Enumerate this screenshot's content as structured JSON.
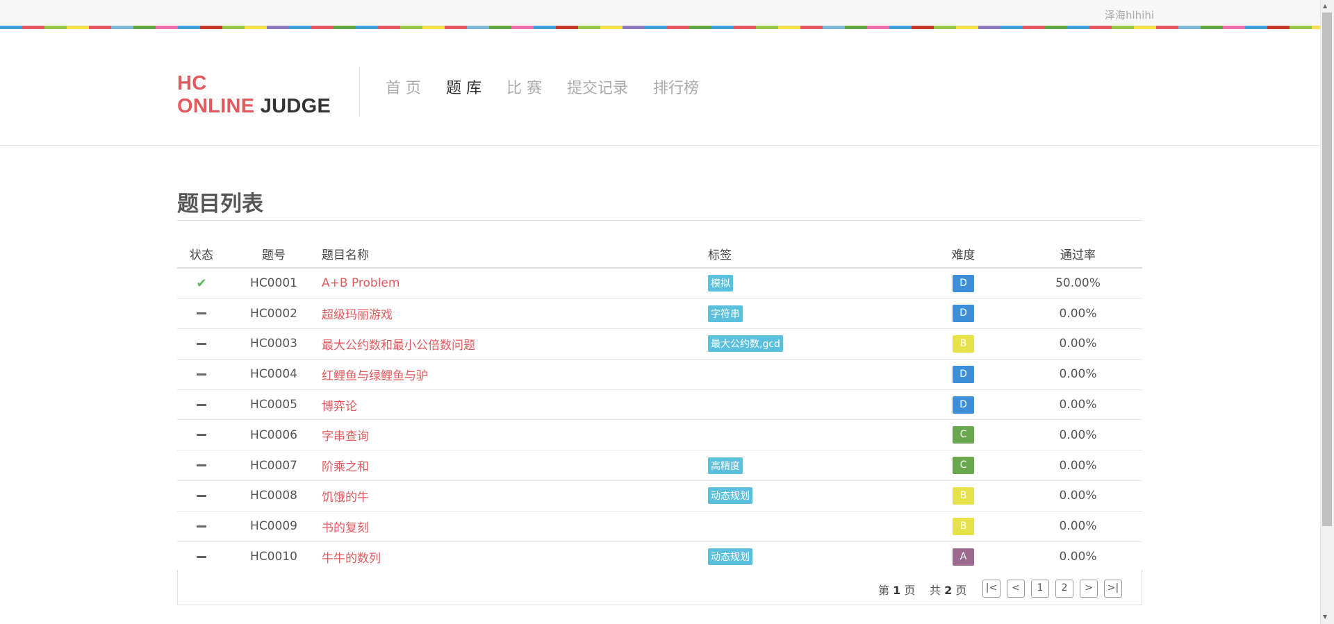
{
  "topbar": {
    "username": "泽海hlhihi"
  },
  "stripe_colors": [
    "#3ea3dc",
    "#e25a5e",
    "#9bc748",
    "#f4e04d",
    "#e25a5e",
    "#7fb7d6",
    "#5fa843",
    "#ee6fa8",
    "#3ea3dc",
    "#c0392b",
    "#9bc748",
    "#f4e04d",
    "#8e7cc3",
    "#3ea3dc",
    "#e25a5e",
    "#5fa843"
  ],
  "logo": {
    "line1": "HC",
    "line2_red": "ONLINE",
    "line2_dark": "JUDGE"
  },
  "nav": [
    {
      "label": "首 页",
      "active": false
    },
    {
      "label": "题 库",
      "active": true
    },
    {
      "label": "比 赛",
      "active": false
    },
    {
      "label": "提交记录",
      "active": false
    },
    {
      "label": "排行榜",
      "active": false
    }
  ],
  "page": {
    "title": "题目列表"
  },
  "table": {
    "headers": {
      "status": "状态",
      "id": "题号",
      "name": "题目名称",
      "tags": "标签",
      "difficulty": "难度",
      "rate": "通过率"
    },
    "rows": [
      {
        "status": "accepted",
        "id": "HC0001",
        "name": "A+B Problem",
        "tag": "模拟",
        "difficulty": "D",
        "rate": "50.00%"
      },
      {
        "status": "none",
        "id": "HC0002",
        "name": "超级玛丽游戏",
        "tag": "字符串",
        "difficulty": "D",
        "rate": "0.00%"
      },
      {
        "status": "none",
        "id": "HC0003",
        "name": "最大公约数和最小公倍数问题",
        "tag": "最大公约数,gcd",
        "difficulty": "B",
        "rate": "0.00%"
      },
      {
        "status": "none",
        "id": "HC0004",
        "name": "红鲤鱼与绿鲤鱼与驴",
        "tag": "",
        "difficulty": "D",
        "rate": "0.00%"
      },
      {
        "status": "none",
        "id": "HC0005",
        "name": "博弈论",
        "tag": "",
        "difficulty": "D",
        "rate": "0.00%"
      },
      {
        "status": "none",
        "id": "HC0006",
        "name": "字串查询",
        "tag": "",
        "difficulty": "C",
        "rate": "0.00%"
      },
      {
        "status": "none",
        "id": "HC0007",
        "name": "阶乘之和",
        "tag": "高精度",
        "difficulty": "C",
        "rate": "0.00%"
      },
      {
        "status": "none",
        "id": "HC0008",
        "name": "饥饿的牛",
        "tag": "动态规划",
        "difficulty": "B",
        "rate": "0.00%"
      },
      {
        "status": "none",
        "id": "HC0009",
        "name": "书的复刻",
        "tag": "",
        "difficulty": "B",
        "rate": "0.00%"
      },
      {
        "status": "none",
        "id": "HC0010",
        "name": "牛牛的数列",
        "tag": "动态规划",
        "difficulty": "A",
        "rate": "0.00%"
      }
    ]
  },
  "difficulty_colors": {
    "A": "#9b6a8e",
    "B": "#e8e24a",
    "C": "#6aa84f",
    "D": "#3c8fd8"
  },
  "pagination": {
    "page_prefix": "第",
    "current": "1",
    "page_suffix": "页",
    "total_prefix": "共",
    "total": "2",
    "total_suffix": "页",
    "buttons": [
      "|<",
      "<",
      "1",
      "2",
      ">",
      ">|"
    ]
  }
}
